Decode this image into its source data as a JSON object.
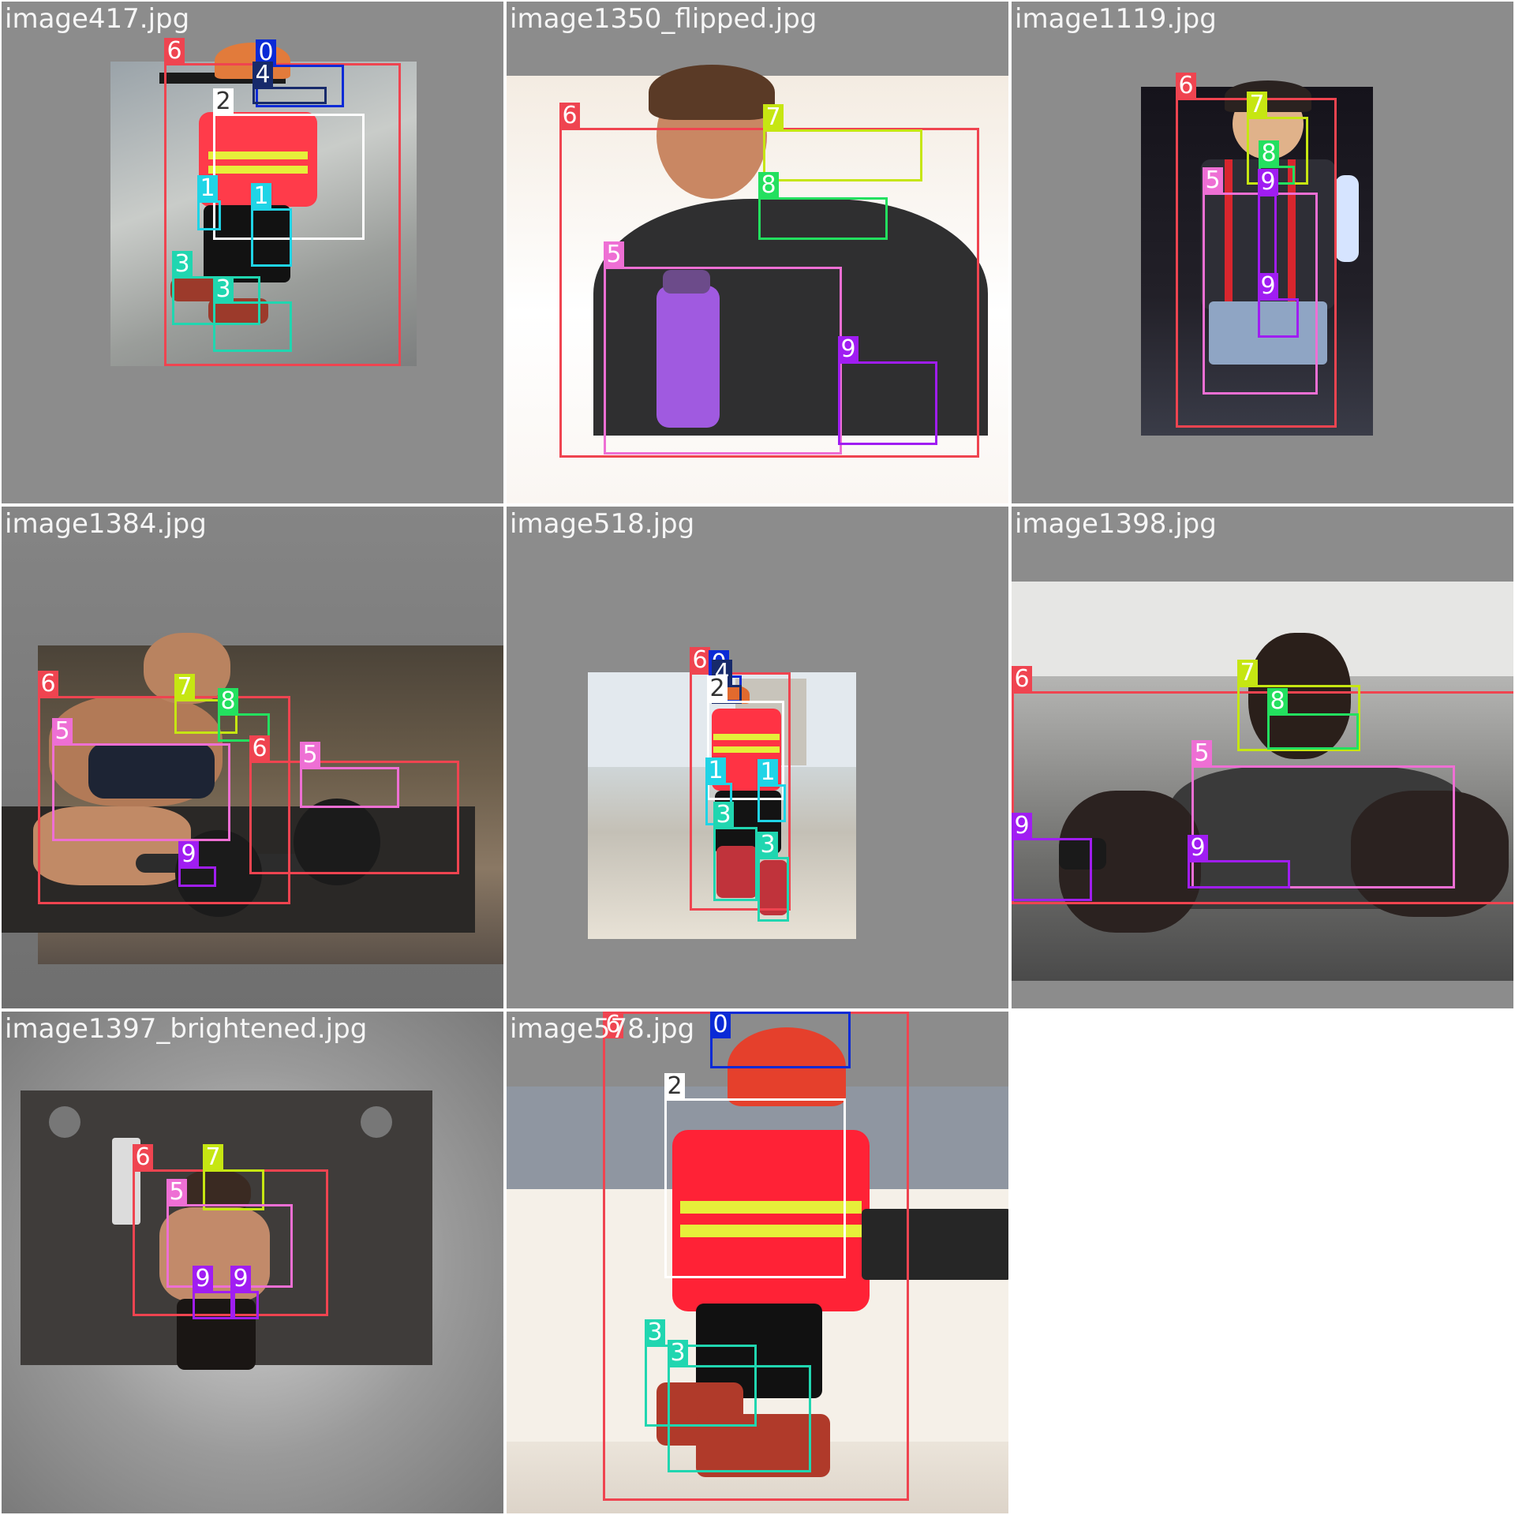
{
  "palette": {
    "0": "#0a2ad6",
    "1": "#1fd4e6",
    "2": "#ffffff",
    "3": "#20d6b0",
    "4": "#172a6b",
    "5": "#ee6fd4",
    "6": "#ef4450",
    "7": "#c6e612",
    "8": "#23e05f",
    "9": "#a01df2"
  },
  "tag_text_color": {
    "2": "dark"
  },
  "tiles": [
    {
      "filename": "image417.jpg",
      "photo_style": "linear-gradient(160deg,#9aa3a9 0%,#c9ccc9 40%,#9a9d9a 70%,#7d7f7f 100%)",
      "figure": "vest-worker",
      "boxes": [
        {
          "label": "6"
        },
        {
          "label": "0"
        },
        {
          "label": "4"
        },
        {
          "label": "2"
        },
        {
          "label": "1"
        },
        {
          "label": "1"
        },
        {
          "label": "3"
        },
        {
          "label": "3"
        }
      ]
    },
    {
      "filename": "image1350_flipped.jpg",
      "photo_style": "linear-gradient(180deg,#f4ece2 0%,#ffffff 55%,#faf6f2 100%)",
      "figure": "woman-bottle",
      "boxes": [
        {
          "label": "6"
        },
        {
          "label": "7"
        },
        {
          "label": "8"
        },
        {
          "label": "5"
        },
        {
          "label": "9"
        }
      ]
    },
    {
      "filename": "image1119.jpg",
      "photo_style": "linear-gradient(180deg,#15131b 0%,#222028 60%,#3a3c48 100%)",
      "figure": "performer",
      "boxes": [
        {
          "label": "6"
        },
        {
          "label": "7"
        },
        {
          "label": "8"
        },
        {
          "label": "5"
        },
        {
          "label": "9"
        },
        {
          "label": "9"
        }
      ]
    },
    {
      "filename": "image1384.jpg",
      "photo_style": "linear-gradient(180deg,#4b4338 0%,#6c5e4b 40%,#8a7864 70%,#5a5048 100%)",
      "figure": "deadlift",
      "boxes": [
        {
          "label": "6"
        },
        {
          "label": "7"
        },
        {
          "label": "8"
        },
        {
          "label": "5"
        },
        {
          "label": "9"
        },
        {
          "label": "6"
        },
        {
          "label": "5"
        }
      ]
    },
    {
      "filename": "image518.jpg",
      "photo_style": "linear-gradient(180deg,#dfe7ee 0%,#cfd6d8 35%,#c4c0b6 60%,#e8e2d6 100%)",
      "figure": "small-worker",
      "boxes": [
        {
          "label": "6"
        },
        {
          "label": "0"
        },
        {
          "label": "4"
        },
        {
          "label": "2"
        },
        {
          "label": "1"
        },
        {
          "label": "1"
        },
        {
          "label": "3"
        },
        {
          "label": "3"
        }
      ]
    },
    {
      "filename": "image1398.jpg",
      "photo_style": "linear-gradient(180deg,#d8d8d6 0%,#a4a4a2 35%,#6e6e6c 70%,#4a4a4a 100%)",
      "figure": "sitting-man",
      "boxes": [
        {
          "label": "6"
        },
        {
          "label": "7"
        },
        {
          "label": "8"
        },
        {
          "label": "5"
        },
        {
          "label": "9"
        },
        {
          "label": "9"
        }
      ]
    },
    {
      "filename": "image1397_brightened.jpg",
      "photo_style": "linear-gradient(90deg,#2a2a2a 0%,#4a4745 30%,#6b6360 50%,#4a4745 70%,#2a2a2a 100%)",
      "figure": "cable-press",
      "boxes": [
        {
          "label": "6"
        },
        {
          "label": "7"
        },
        {
          "label": "5"
        },
        {
          "label": "9"
        },
        {
          "label": "9"
        }
      ]
    },
    {
      "filename": "image578.jpg",
      "photo_style": "linear-gradient(180deg,#8c93a0 0%,#c9c8c4 20%,#f6f3ee 45%,#f2ece2 75%,#dcd3c8 100%)",
      "figure": "big-worker",
      "boxes": [
        {
          "label": "6"
        },
        {
          "label": "0"
        },
        {
          "label": "2"
        },
        {
          "label": "3"
        },
        {
          "label": "3"
        }
      ]
    }
  ]
}
